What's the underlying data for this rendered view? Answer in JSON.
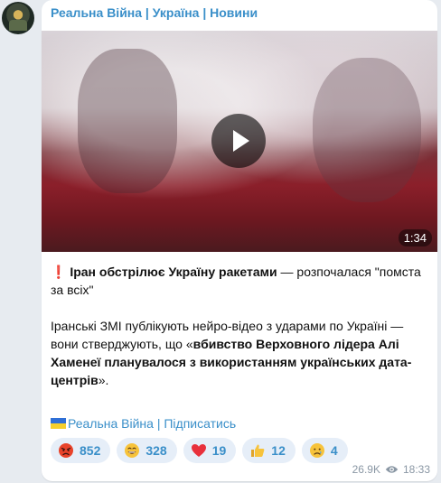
{
  "channel": {
    "name": "Реальна Війна | Україна | Новини"
  },
  "video": {
    "duration": "1:34"
  },
  "post": {
    "excl": "❗",
    "headline_bold": "Іран обстрілює Україну ракетами",
    "headline_rest": " — розпочалася \"помста за всіх\"",
    "para2_start": "Іранські ЗМІ публікують нейро-відео з ударами по Україні — вони стверджують, що «",
    "para2_bold": "вбивство Верховного лідера Алі Хаменеї планувалося з використанням українських дата-центрів",
    "para2_end": "»."
  },
  "subscribe": {
    "text": "Реальна Війна | Підписатись",
    "flag_colors": [
      "#2f6fd6",
      "#f5cf2c"
    ]
  },
  "reactions": [
    {
      "icon": "angry-face-icon",
      "count": "852"
    },
    {
      "icon": "grinning-face-icon",
      "count": "328"
    },
    {
      "icon": "heart-icon",
      "count": "19"
    },
    {
      "icon": "thumbs-up-icon",
      "count": "12"
    },
    {
      "icon": "crying-face-icon",
      "count": "4"
    }
  ],
  "meta": {
    "views": "26.9K",
    "time": "18:33"
  },
  "colors": {
    "accent": "#3a8fc9",
    "background": "#e7ebf0",
    "bubble": "#ffffff"
  }
}
